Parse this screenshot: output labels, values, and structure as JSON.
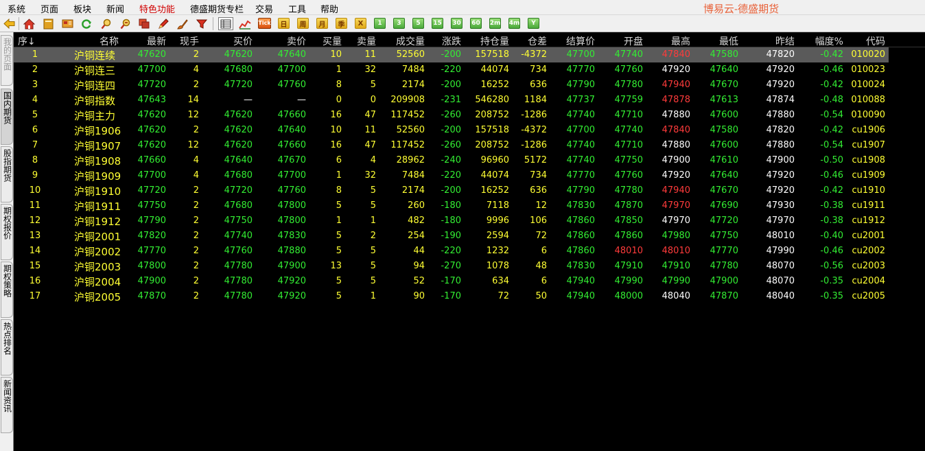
{
  "menu": {
    "items": [
      "系统",
      "页面",
      "板块",
      "新闻",
      "特色功能",
      "德盛期货专栏",
      "交易",
      "工具",
      "帮助"
    ],
    "special_index": 4
  },
  "app_title": "博易云-德盛期货",
  "toolbar": {
    "icons": [
      "back-arrow-icon",
      "home-icon",
      "book-icon",
      "news-icon",
      "refresh-icon",
      "zoom-in-icon",
      "zoom-out-icon",
      "window-icon",
      "pen-icon",
      "brush-icon",
      "filter-icon",
      "table-icon",
      "chart-icon",
      "tick-icon"
    ],
    "tick_label": "Tick",
    "periods": [
      "日",
      "周",
      "月",
      "季",
      "X",
      "1",
      "3",
      "5",
      "15",
      "30",
      "60",
      "2m",
      "4m",
      "Y"
    ]
  },
  "sidetabs": [
    "我的页面",
    "国内期货",
    "股指期货",
    "期权报价",
    "期权策略",
    "热点排名",
    "新闻资讯"
  ],
  "table": {
    "headers": [
      "序↓",
      "名称",
      "最新",
      "现手",
      "买价",
      "卖价",
      "买量",
      "卖量",
      "成交量",
      "涨跌",
      "持仓量",
      "仓差",
      "结算价",
      "开盘",
      "最高",
      "最低",
      "昨结",
      "幅度%",
      "代码"
    ],
    "rows": [
      [
        "1",
        "沪铜连续",
        "47620",
        "2",
        "47620",
        "47640",
        "10",
        "11",
        "52560",
        "-200",
        "157518",
        "-4372",
        "47700",
        "47740",
        "47840",
        "47580",
        "47820",
        "-0.42",
        "010020"
      ],
      [
        "2",
        "沪铜连三",
        "47700",
        "4",
        "47680",
        "47700",
        "1",
        "32",
        "7484",
        "-220",
        "44074",
        "734",
        "47770",
        "47760",
        "47920",
        "47640",
        "47920",
        "-0.46",
        "010023"
      ],
      [
        "3",
        "沪铜连四",
        "47720",
        "2",
        "47720",
        "47760",
        "8",
        "5",
        "2174",
        "-200",
        "16252",
        "636",
        "47790",
        "47780",
        "47940",
        "47670",
        "47920",
        "-0.42",
        "010024"
      ],
      [
        "4",
        "沪铜指数",
        "47643",
        "14",
        "—",
        "—",
        "0",
        "0",
        "209908",
        "-231",
        "546280",
        "1184",
        "47737",
        "47759",
        "47878",
        "47613",
        "47874",
        "-0.48",
        "010088"
      ],
      [
        "5",
        "沪铜主力",
        "47620",
        "12",
        "47620",
        "47660",
        "16",
        "47",
        "117452",
        "-260",
        "208752",
        "-1286",
        "47740",
        "47710",
        "47880",
        "47600",
        "47880",
        "-0.54",
        "010090"
      ],
      [
        "6",
        "沪铜1906",
        "47620",
        "2",
        "47620",
        "47640",
        "10",
        "11",
        "52560",
        "-200",
        "157518",
        "-4372",
        "47700",
        "47740",
        "47840",
        "47580",
        "47820",
        "-0.42",
        "cu1906"
      ],
      [
        "7",
        "沪铜1907",
        "47620",
        "12",
        "47620",
        "47660",
        "16",
        "47",
        "117452",
        "-260",
        "208752",
        "-1286",
        "47740",
        "47710",
        "47880",
        "47600",
        "47880",
        "-0.54",
        "cu1907"
      ],
      [
        "8",
        "沪铜1908",
        "47660",
        "4",
        "47640",
        "47670",
        "6",
        "4",
        "28962",
        "-240",
        "96960",
        "5172",
        "47740",
        "47750",
        "47900",
        "47610",
        "47900",
        "-0.50",
        "cu1908"
      ],
      [
        "9",
        "沪铜1909",
        "47700",
        "4",
        "47680",
        "47700",
        "1",
        "32",
        "7484",
        "-220",
        "44074",
        "734",
        "47770",
        "47760",
        "47920",
        "47640",
        "47920",
        "-0.46",
        "cu1909"
      ],
      [
        "10",
        "沪铜1910",
        "47720",
        "2",
        "47720",
        "47760",
        "8",
        "5",
        "2174",
        "-200",
        "16252",
        "636",
        "47790",
        "47780",
        "47940",
        "47670",
        "47920",
        "-0.42",
        "cu1910"
      ],
      [
        "11",
        "沪铜1911",
        "47750",
        "2",
        "47680",
        "47800",
        "5",
        "5",
        "260",
        "-180",
        "7118",
        "12",
        "47830",
        "47870",
        "47970",
        "47690",
        "47930",
        "-0.38",
        "cu1911"
      ],
      [
        "12",
        "沪铜1912",
        "47790",
        "2",
        "47750",
        "47800",
        "1",
        "1",
        "482",
        "-180",
        "9996",
        "106",
        "47860",
        "47850",
        "47970",
        "47720",
        "47970",
        "-0.38",
        "cu1912"
      ],
      [
        "13",
        "沪铜2001",
        "47820",
        "2",
        "47740",
        "47830",
        "5",
        "2",
        "254",
        "-190",
        "2594",
        "72",
        "47860",
        "47860",
        "47980",
        "47750",
        "48010",
        "-0.40",
        "cu2001"
      ],
      [
        "14",
        "沪铜2002",
        "47770",
        "2",
        "47760",
        "47880",
        "5",
        "5",
        "44",
        "-220",
        "1232",
        "6",
        "47860",
        "48010",
        "48010",
        "47770",
        "47990",
        "-0.46",
        "cu2002"
      ],
      [
        "15",
        "沪铜2003",
        "47800",
        "2",
        "47780",
        "47900",
        "13",
        "5",
        "94",
        "-270",
        "1078",
        "48",
        "47830",
        "47910",
        "47910",
        "47780",
        "48070",
        "-0.56",
        "cu2003"
      ],
      [
        "16",
        "沪铜2004",
        "47900",
        "2",
        "47780",
        "47920",
        "5",
        "5",
        "52",
        "-170",
        "634",
        "6",
        "47940",
        "47990",
        "47990",
        "47900",
        "48070",
        "-0.35",
        "cu2004"
      ],
      [
        "17",
        "沪铜2005",
        "47870",
        "2",
        "47780",
        "47920",
        "5",
        "1",
        "90",
        "-170",
        "72",
        "50",
        "47940",
        "48000",
        "48040",
        "47870",
        "48040",
        "-0.35",
        "cu2005"
      ]
    ],
    "colors": {
      "yellow": "#ffff33",
      "green": "#33ee33",
      "white": "#ffffff",
      "red": "#ff3b3b"
    },
    "selected_row": 0
  }
}
